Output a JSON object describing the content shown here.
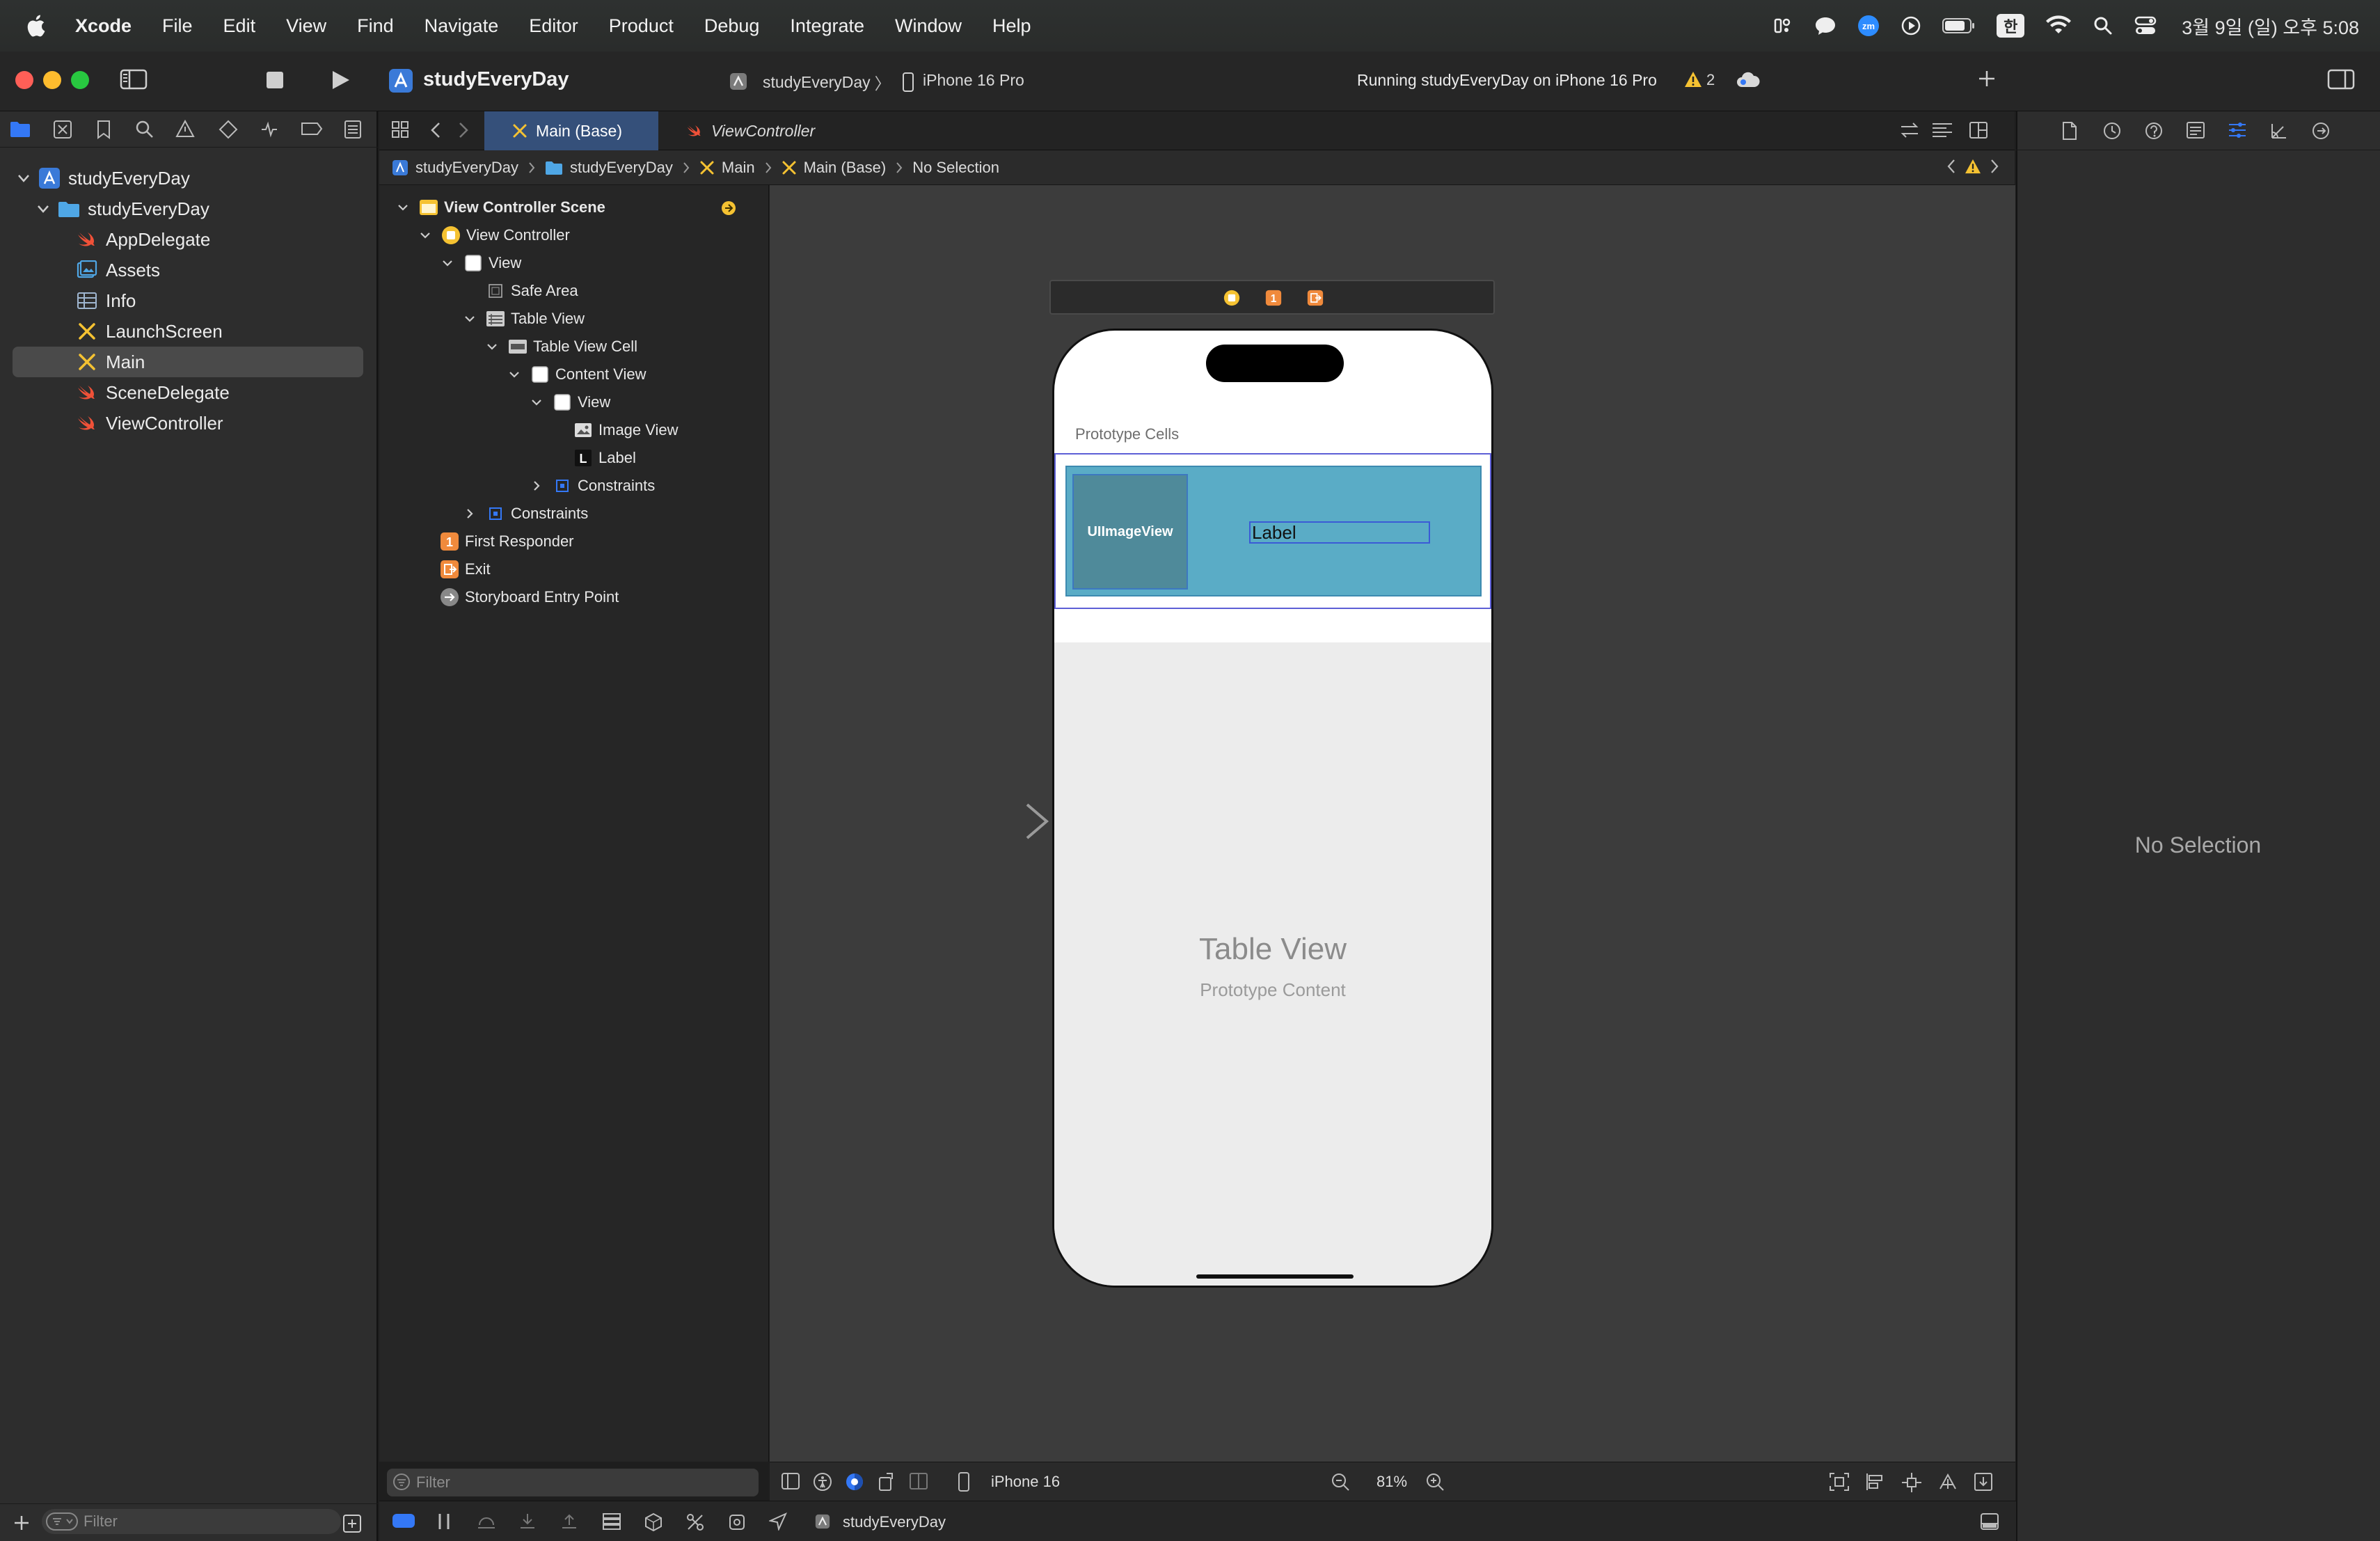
{
  "menubar": {
    "app_name": "Xcode",
    "items": [
      "File",
      "Edit",
      "View",
      "Find",
      "Navigate",
      "Editor",
      "Product",
      "Debug",
      "Integrate",
      "Window",
      "Help"
    ],
    "input_method": "한",
    "clock": "3월 9일 (일) 오후 5:08"
  },
  "toolbar": {
    "project_title": "studyEveryDay",
    "scheme": "studyEveryDay",
    "scheme_sep": "〉",
    "device": "iPhone 16 Pro",
    "run_status": "Running studyEveryDay on iPhone 16 Pro",
    "warning_count": "2"
  },
  "navigator": {
    "items": [
      {
        "label": "studyEveryDay",
        "icon": "project-icon"
      },
      {
        "label": "studyEveryDay",
        "icon": "folder-icon"
      },
      {
        "label": "AppDelegate",
        "icon": "swift-icon"
      },
      {
        "label": "Assets",
        "icon": "assets-icon"
      },
      {
        "label": "Info",
        "icon": "plist-icon"
      },
      {
        "label": "LaunchScreen",
        "icon": "storyboard-icon"
      },
      {
        "label": "Main",
        "icon": "storyboard-icon"
      },
      {
        "label": "SceneDelegate",
        "icon": "swift-icon"
      },
      {
        "label": "ViewController",
        "icon": "swift-icon"
      }
    ],
    "filter_placeholder": "Filter"
  },
  "tabs": {
    "main": "Main (Base)",
    "vc": "ViewController"
  },
  "jumpbar": {
    "crumbs": [
      "studyEveryDay",
      "studyEveryDay",
      "Main",
      "Main (Base)",
      "No Selection"
    ]
  },
  "outline": {
    "items": [
      {
        "label": "View Controller Scene"
      },
      {
        "label": "View Controller"
      },
      {
        "label": "View"
      },
      {
        "label": "Safe Area"
      },
      {
        "label": "Table View"
      },
      {
        "label": "Table View Cell"
      },
      {
        "label": "Content View"
      },
      {
        "label": "View"
      },
      {
        "label": "Image View"
      },
      {
        "label": "Label"
      },
      {
        "label": "Constraints"
      },
      {
        "label": "Constraints"
      },
      {
        "label": "First Responder"
      },
      {
        "label": "Exit"
      },
      {
        "label": "Storyboard Entry Point"
      }
    ],
    "filter_placeholder": "Filter"
  },
  "canvas": {
    "prototype_cells": "Prototype Cells",
    "imageview_text": "UIImageView",
    "label_text": "Label",
    "table_view_title": "Table View",
    "table_view_sub": "Prototype Content",
    "device": "iPhone 16",
    "zoom": "81%"
  },
  "inspector": {
    "no_selection": "No Selection"
  },
  "debug": {
    "target": "studyEveryDay"
  },
  "colors": {
    "accent": "#3478f6",
    "selected_tab": "#35507a",
    "cell_bg": "#5aacc6",
    "warning": "#f5c232"
  }
}
